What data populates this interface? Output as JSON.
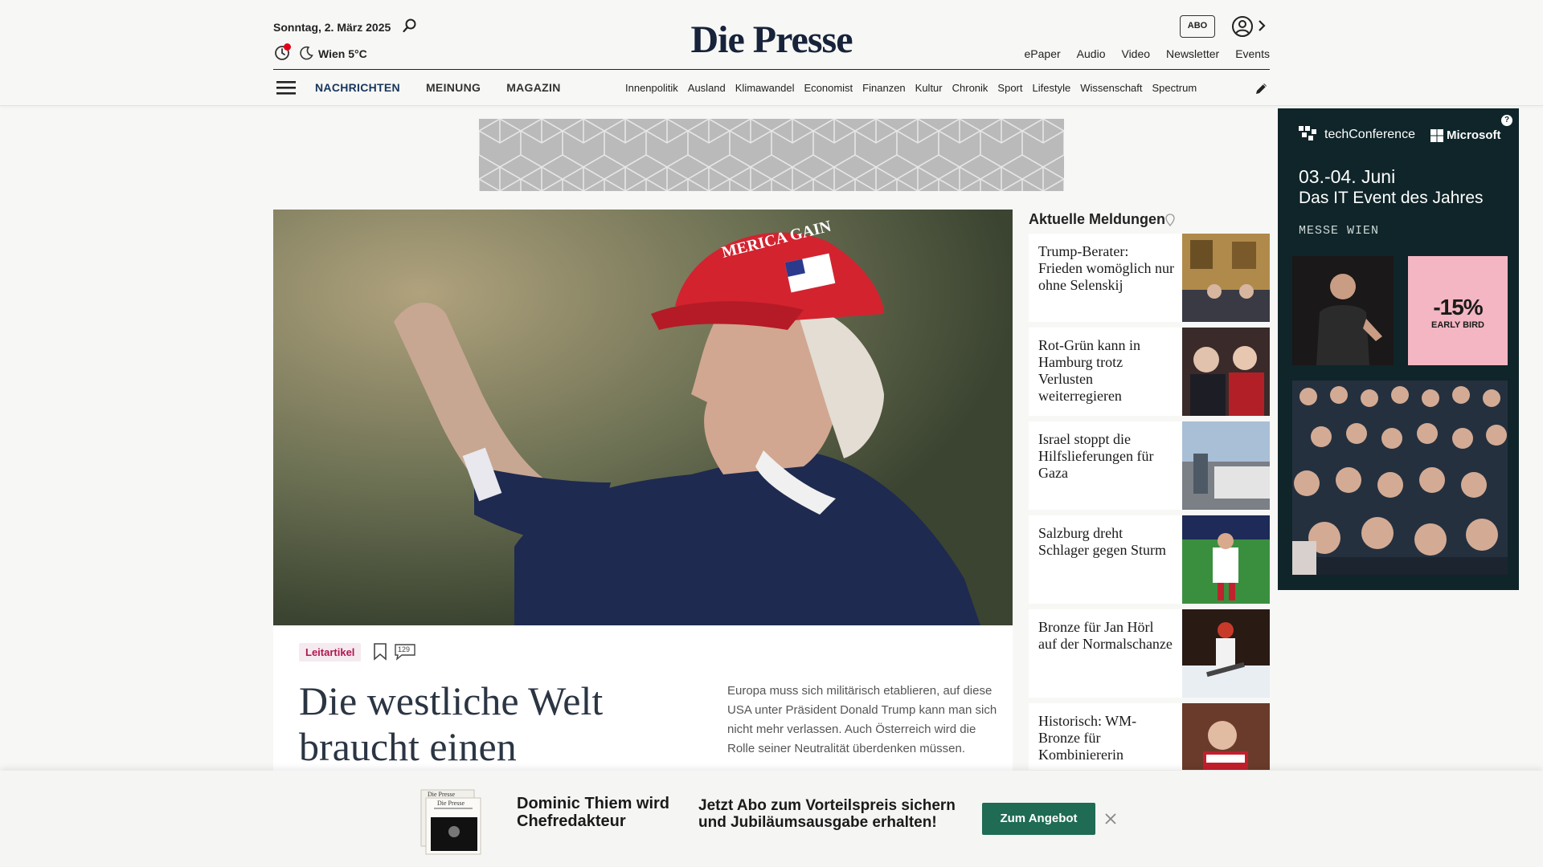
{
  "header": {
    "date": "Sonntag, 2. März 2025",
    "weather": "Wien 5°C",
    "logo": "Die Presse",
    "abo_label": "ABO",
    "top_links": [
      "ePaper",
      "Audio",
      "Video",
      "Newsletter",
      "Events"
    ],
    "main_nav": [
      "NACHRICHTEN",
      "MEINUNG",
      "MAGAZIN"
    ],
    "sub_nav": [
      "Innenpolitik",
      "Ausland",
      "Klimawandel",
      "Economist",
      "Finanzen",
      "Kultur",
      "Chronik",
      "Sport",
      "Lifestyle",
      "Wissenschaft",
      "Spectrum"
    ]
  },
  "hero": {
    "tag": "Leitartikel",
    "comment_count": "129",
    "headline": "Die westliche Welt braucht einen",
    "teaser": "Europa muss sich militärisch etablieren, auf diese USA unter Präsident Donald Trump kann man sich nicht mehr verlassen. Auch Österreich wird die Rolle seiner Neutralität überdenken müssen.",
    "cap_text": "MERICA GAIN"
  },
  "news": {
    "title": "Aktuelle Meldungen",
    "items": [
      {
        "text": "Trump-Berater: Frieden womöglich nur ohne Selenskij"
      },
      {
        "text": "Rot-Grün kann in Hamburg trotz Verlusten weiterregieren"
      },
      {
        "text": "Israel stoppt die Hilfslieferungen für Gaza"
      },
      {
        "text": "Salzburg dreht Schlager gegen Sturm"
      },
      {
        "text": "Bronze für Jan Hörl auf der Normalschanze"
      },
      {
        "text": "Historisch: WM-Bronze für Kombiniererin"
      }
    ]
  },
  "ad_right": {
    "info": "?",
    "brand": "techConference",
    "partner": "Microsoft",
    "date": "03.-04. Juni",
    "subtitle": "Das IT Event des Jahres",
    "location": "MESSE WIEN",
    "discount": "-15%",
    "early_bird": "EARLY BIRD"
  },
  "bottom_bar": {
    "title": "Dominic Thiem wird Chefredakteur",
    "pitch": "Jetzt Abo zum Vorteilspreis sichern und Jubiläumsausgabe erhalten!",
    "button": "Zum Angebot",
    "paper_label": "Die Presse"
  },
  "colors": {
    "brand_navy": "#17233b",
    "tag_pink": "#b0174f",
    "cta_green": "#1f6b54",
    "ad_bg": "#0f2529",
    "ad_pink": "#f3b6c2"
  }
}
